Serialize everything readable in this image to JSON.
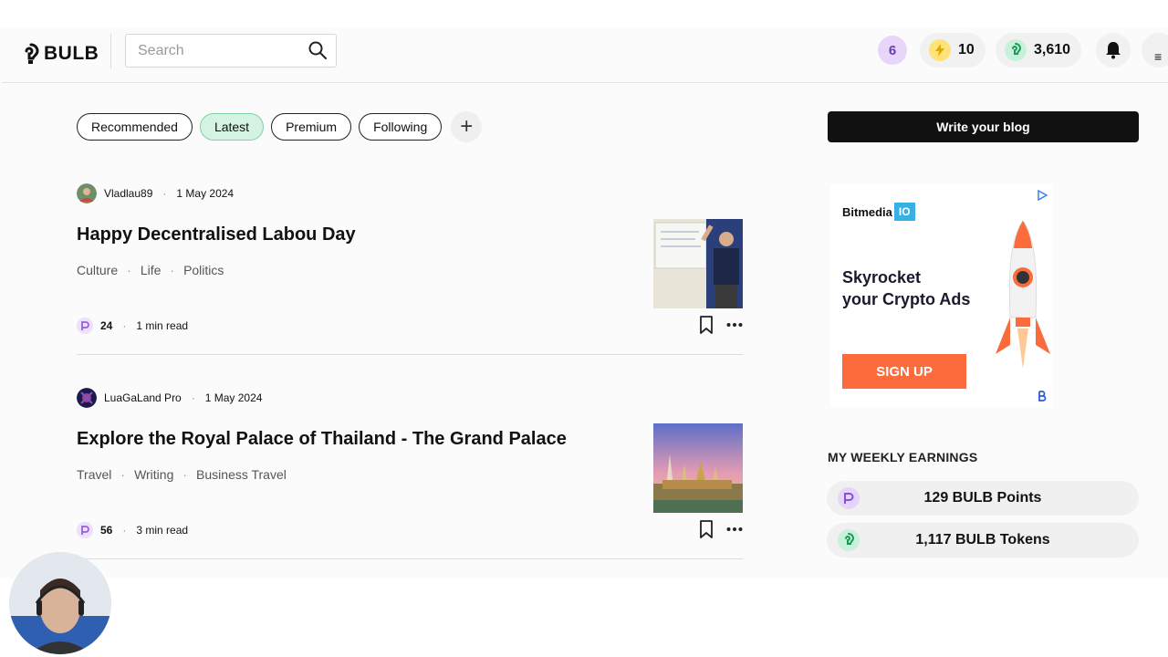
{
  "header": {
    "logo_text": "BULB",
    "search_placeholder": "Search",
    "badge_level": "6",
    "energy": "10",
    "tokens": "3,610"
  },
  "tabs": [
    "Recommended",
    "Latest",
    "Premium",
    "Following"
  ],
  "active_tab": "Latest",
  "posts": [
    {
      "author": "Vladlau89",
      "date": "1 May 2024",
      "title": "Happy Decentralised Labou Day",
      "tags": [
        "Culture",
        "Life",
        "Politics"
      ],
      "points": "24",
      "read_time": "1 min read"
    },
    {
      "author": "LuaGaLand Pro",
      "date": "1 May 2024",
      "title": "Explore the Royal Palace of Thailand - The Grand Palace",
      "tags": [
        "Travel",
        "Writing",
        "Business Travel"
      ],
      "points": "56",
      "read_time": "3 min read"
    }
  ],
  "sidebar": {
    "write_button": "Write your blog",
    "ad": {
      "brand": "Bitmedia",
      "brand_suffix": "IO",
      "headline_line1": "Skyrocket",
      "headline_line2": "your Crypto Ads",
      "cta": "SIGN UP"
    },
    "weekly_title": "MY WEEKLY EARNINGS",
    "points_label": "129 BULB Points",
    "tokens_label": "1,117 BULB Tokens"
  },
  "colors": {
    "active_tab_bg": "#d4f3e2",
    "accent_purple": "#9b5de5",
    "accent_green": "#2fbf71",
    "energy_yellow": "#ffd84d",
    "ad_orange": "#fb6b3c"
  },
  "icons": {
    "search": "search-icon",
    "bell": "bell-icon",
    "menu": "menu-icon",
    "bookmark": "bookmark-icon",
    "more": "more-icon",
    "plus": "plus-icon"
  }
}
